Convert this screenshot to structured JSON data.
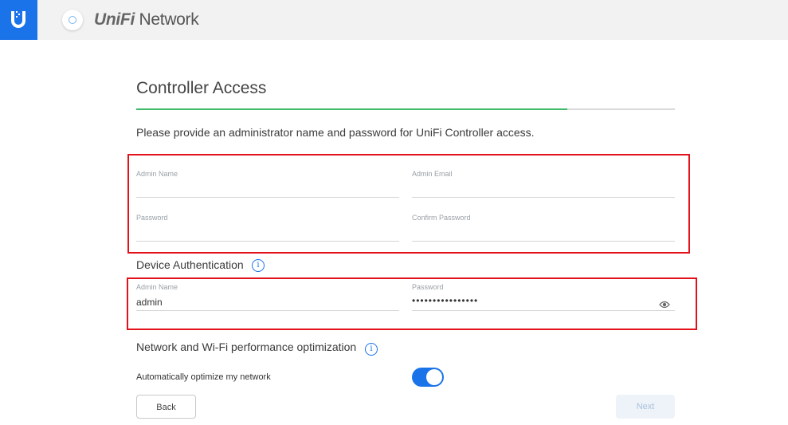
{
  "header": {
    "brand_prefix": "UniFi",
    "brand_suffix": " Network"
  },
  "page": {
    "title": "Controller Access",
    "progress_percent": 80,
    "intro": "Please provide an administrator name and password for UniFi Controller access."
  },
  "controller_form": {
    "admin_name": {
      "label": "Admin Name",
      "value": ""
    },
    "admin_email": {
      "label": "Admin Email",
      "value": ""
    },
    "password": {
      "label": "Password",
      "value": ""
    },
    "confirm_password": {
      "label": "Confirm Password",
      "value": ""
    }
  },
  "device_auth": {
    "title": "Device Authentication",
    "info_glyph": "i",
    "admin_name": {
      "label": "Admin Name",
      "value": "admin"
    },
    "password": {
      "label": "Password",
      "value": "••••••••••••••••"
    }
  },
  "optimization": {
    "title": "Network and Wi-Fi performance optimization",
    "info_glyph": "i",
    "toggle_label": "Automatically optimize my network",
    "toggle_on": true
  },
  "buttons": {
    "back": "Back",
    "next": "Next"
  },
  "colors": {
    "accent": "#1a73e8",
    "progress": "#3dbb6b",
    "highlight": "#e3111a"
  },
  "icons": [
    "unifi-logo-icon",
    "ring-icon",
    "info-icon",
    "eye-icon"
  ]
}
